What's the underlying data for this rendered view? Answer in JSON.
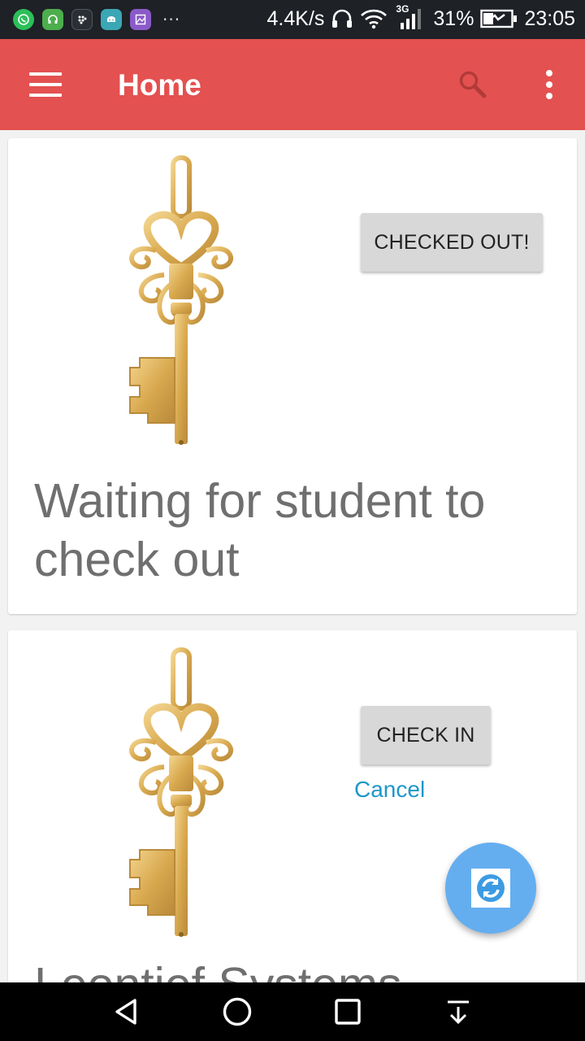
{
  "status_bar": {
    "notification_icons": [
      "whatsapp-icon",
      "headset-app-icon",
      "blackberry-icon",
      "android-icon",
      "gallery-icon"
    ],
    "more_indicator": "···",
    "network_speed": "4.4K/s",
    "network_type": "3G",
    "battery_percent": "31%",
    "time": "23:05"
  },
  "app_bar": {
    "title": "Home",
    "background_color": "#e35150"
  },
  "cards": [
    {
      "image": "gold-heart-key-image",
      "button_label": "CHECKED OUT!",
      "status_text": "Waiting for student to check out"
    },
    {
      "image": "gold-heart-key-image",
      "button_label": "CHECK IN",
      "cancel_label": "Cancel",
      "title_text": "Leontief Systems"
    }
  ],
  "fab": {
    "icon": "refresh-icon",
    "color": "#64aef0"
  },
  "colors": {
    "cancel_link": "#1e97c9",
    "card_text": "#6f6f6f"
  }
}
